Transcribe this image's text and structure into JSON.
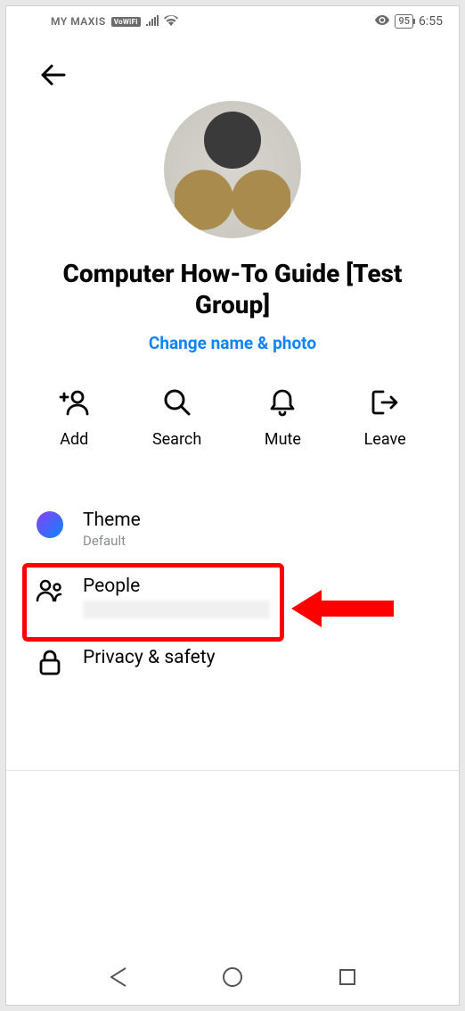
{
  "status": {
    "carrier": "MY MAXIS",
    "vowifi": "VoWiFi",
    "battery": "95",
    "time": "6:55"
  },
  "group": {
    "title": "Computer How-To Guide [Test Group]",
    "change_link": "Change name & photo"
  },
  "actions": {
    "add": "Add",
    "search": "Search",
    "mute": "Mute",
    "leave": "Leave"
  },
  "settings": {
    "theme": {
      "label": "Theme",
      "sub": "Default"
    },
    "people": {
      "label": "People"
    },
    "privacy": {
      "label": "Privacy & safety"
    }
  }
}
